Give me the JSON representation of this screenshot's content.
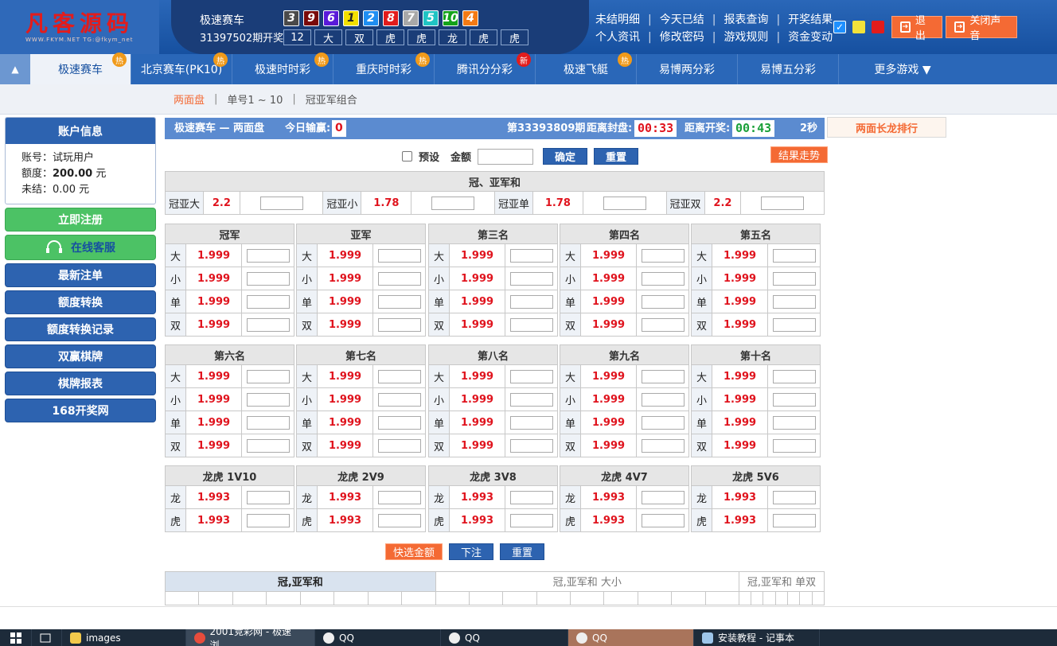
{
  "logo": {
    "title": "凡客源码",
    "sub": "WWW.FKYM.NET  TG:@fkym_net"
  },
  "header": {
    "game_name": "极速赛车",
    "period_text": "31397502期开奖",
    "balls": [
      {
        "num": "3",
        "color": "#4a4a4a"
      },
      {
        "num": "9",
        "color": "#7a0a0a"
      },
      {
        "num": "6",
        "color": "#5a1ad9"
      },
      {
        "num": "1",
        "color": "#f2e000"
      },
      {
        "num": "2",
        "color": "#1f8ef2"
      },
      {
        "num": "8",
        "color": "#e21c1c"
      },
      {
        "num": "7",
        "color": "#a8a8a8"
      },
      {
        "num": "5",
        "color": "#20c4c4"
      },
      {
        "num": "10",
        "color": "#14a21a"
      },
      {
        "num": "4",
        "color": "#f47a14"
      }
    ],
    "draws": [
      "12",
      "大",
      "双",
      "虎",
      "虎",
      "龙",
      "虎",
      "虎"
    ],
    "links_row1": [
      "未结明细",
      "今天已结",
      "报表查询",
      "开奖结果"
    ],
    "links_row2": [
      "个人资讯",
      "修改密码",
      "游戏规则",
      "资金变动"
    ],
    "logout": "退出",
    "mute": "关闭声音"
  },
  "nav": {
    "items": [
      {
        "label": "极速赛车",
        "tag": "热",
        "tag_color": "#f09a1a"
      },
      {
        "label": "北京赛车(PK10)",
        "tag": "热",
        "tag_color": "#f09a1a"
      },
      {
        "label": "极速时时彩",
        "tag": "热",
        "tag_color": "#f09a1a"
      },
      {
        "label": "重庆时时彩",
        "tag": "热",
        "tag_color": "#f09a1a"
      },
      {
        "label": "腾讯分分彩",
        "tag": "新",
        "tag_color": "#e21c1c"
      },
      {
        "label": "极速飞艇",
        "tag": "热",
        "tag_color": "#f09a1a"
      },
      {
        "label": "易博两分彩",
        "tag": "",
        "tag_color": ""
      },
      {
        "label": "易博五分彩",
        "tag": "",
        "tag_color": ""
      },
      {
        "label": "更多游戏 ▼",
        "tag": "",
        "tag_color": ""
      }
    ]
  },
  "subnav": [
    "两面盘",
    "单号1 ~ 10",
    "冠亚军组合"
  ],
  "account": {
    "title": "账户信息",
    "account_label": "账号：",
    "account_value": "试玩用户",
    "credit_label": "额度：",
    "credit_value": "200.00",
    "credit_unit": " 元",
    "unsettled_label": "未结：",
    "unsettled_value": "0.00 元"
  },
  "side_buttons": [
    "立即注册",
    "在线客服",
    "最新注单",
    "额度转换",
    "额度转换记录",
    "双赢棋牌",
    "棋牌报表",
    "168开奖网"
  ],
  "info": {
    "title": "极速赛车 — 两面盘",
    "today_label": "今日输赢:",
    "today_value": "0",
    "period": "第33393809期",
    "close_label": "距离封盘:",
    "close_time": "00:33",
    "open_label": "距离开奖:",
    "open_time": "00:43",
    "refresh": "2秒"
  },
  "long_rank": "两面长龙排行",
  "controls": {
    "preset": "预设",
    "amount_label": "金额",
    "confirm": "确定",
    "reset": "重置",
    "trend": "结果走势"
  },
  "sum_table": {
    "title": "冠、亚军和",
    "cells": [
      {
        "label": "冠亚大",
        "odds": "2.2"
      },
      {
        "label": "冠亚小",
        "odds": "1.78"
      },
      {
        "label": "冠亚单",
        "odds": "1.78"
      },
      {
        "label": "冠亚双",
        "odds": "2.2"
      }
    ]
  },
  "rank_tables": [
    {
      "title": "冠军",
      "rows": [
        [
          "大",
          "1.999"
        ],
        [
          "小",
          "1.999"
        ],
        [
          "单",
          "1.999"
        ],
        [
          "双",
          "1.999"
        ]
      ]
    },
    {
      "title": "亚军",
      "rows": [
        [
          "大",
          "1.999"
        ],
        [
          "小",
          "1.999"
        ],
        [
          "单",
          "1.999"
        ],
        [
          "双",
          "1.999"
        ]
      ]
    },
    {
      "title": "第三名",
      "rows": [
        [
          "大",
          "1.999"
        ],
        [
          "小",
          "1.999"
        ],
        [
          "单",
          "1.999"
        ],
        [
          "双",
          "1.999"
        ]
      ]
    },
    {
      "title": "第四名",
      "rows": [
        [
          "大",
          "1.999"
        ],
        [
          "小",
          "1.999"
        ],
        [
          "单",
          "1.999"
        ],
        [
          "双",
          "1.999"
        ]
      ]
    },
    {
      "title": "第五名",
      "rows": [
        [
          "大",
          "1.999"
        ],
        [
          "小",
          "1.999"
        ],
        [
          "单",
          "1.999"
        ],
        [
          "双",
          "1.999"
        ]
      ]
    },
    {
      "title": "第六名",
      "rows": [
        [
          "大",
          "1.999"
        ],
        [
          "小",
          "1.999"
        ],
        [
          "单",
          "1.999"
        ],
        [
          "双",
          "1.999"
        ]
      ]
    },
    {
      "title": "第七名",
      "rows": [
        [
          "大",
          "1.999"
        ],
        [
          "小",
          "1.999"
        ],
        [
          "单",
          "1.999"
        ],
        [
          "双",
          "1.999"
        ]
      ]
    },
    {
      "title": "第八名",
      "rows": [
        [
          "大",
          "1.999"
        ],
        [
          "小",
          "1.999"
        ],
        [
          "单",
          "1.999"
        ],
        [
          "双",
          "1.999"
        ]
      ]
    },
    {
      "title": "第九名",
      "rows": [
        [
          "大",
          "1.999"
        ],
        [
          "小",
          "1.999"
        ],
        [
          "单",
          "1.999"
        ],
        [
          "双",
          "1.999"
        ]
      ]
    },
    {
      "title": "第十名",
      "rows": [
        [
          "大",
          "1.999"
        ],
        [
          "小",
          "1.999"
        ],
        [
          "单",
          "1.999"
        ],
        [
          "双",
          "1.999"
        ]
      ]
    },
    {
      "title": "龙虎 1V10",
      "rows": [
        [
          "龙",
          "1.993"
        ],
        [
          "虎",
          "1.993"
        ]
      ]
    },
    {
      "title": "龙虎 2V9",
      "rows": [
        [
          "龙",
          "1.993"
        ],
        [
          "虎",
          "1.993"
        ]
      ]
    },
    {
      "title": "龙虎 3V8",
      "rows": [
        [
          "龙",
          "1.993"
        ],
        [
          "虎",
          "1.993"
        ]
      ]
    },
    {
      "title": "龙虎 4V7",
      "rows": [
        [
          "龙",
          "1.993"
        ],
        [
          "虎",
          "1.993"
        ]
      ]
    },
    {
      "title": "龙虎 5V6",
      "rows": [
        [
          "龙",
          "1.993"
        ],
        [
          "虎",
          "1.993"
        ]
      ]
    }
  ],
  "bottom": {
    "quick": "快选金额",
    "bet": "下注",
    "reset": "重置"
  },
  "result_tabs": [
    "冠,亚军和",
    "冠,亚军和 大小",
    "冠,亚军和 单双"
  ],
  "taskbar": [
    "images",
    "2001竞彩网 - 极速浏...",
    "QQ",
    "QQ",
    "QQ",
    "安装教程 - 记事本"
  ]
}
